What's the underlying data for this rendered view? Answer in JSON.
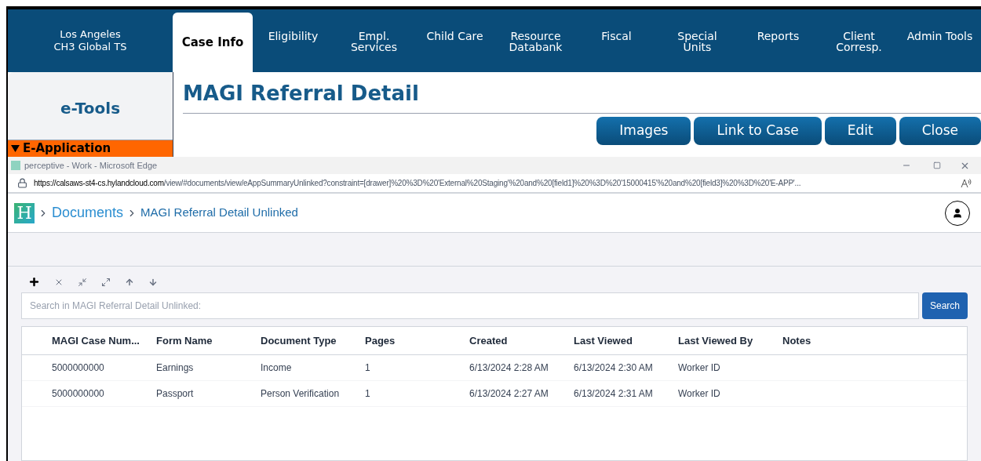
{
  "header": {
    "location": "Los Angeles",
    "office": "CH3 Global TS"
  },
  "tabs": [
    {
      "label": "Case Info",
      "selected": true
    },
    {
      "label": "Eligibility",
      "selected": false
    },
    {
      "label": "Empl. Services",
      "selected": false
    },
    {
      "label": "Child Care",
      "selected": false
    },
    {
      "label": "Resource Databank",
      "selected": false
    },
    {
      "label": "Fiscal",
      "selected": false
    },
    {
      "label": "Special\nUnits",
      "selected": false
    },
    {
      "label": "Reports",
      "selected": false
    },
    {
      "label": "Client Corresp.",
      "selected": false
    },
    {
      "label": "Admin Tools",
      "selected": false
    }
  ],
  "sidebar": {
    "title": "e-Tools",
    "section": {
      "label": "E-Application",
      "expanded": true
    }
  },
  "page": {
    "title": "MAGI Referral Detail",
    "buttons": [
      "Images",
      "Link to Case",
      "Edit",
      "Close"
    ]
  },
  "browser": {
    "title": "perceptive - Work - Microsoft Edge",
    "url_host": "https://calsaws-st4-cs.hylandcloud.com",
    "url_path": "/view/#documents/view/eAppSummaryUnlinked?constraint=[drawer]%20%3D%20'External%20Staging'%20and%20[field1]%20%3D%20'15000415'%20and%20[field3]%20%3D%20'E-APP'..."
  },
  "app": {
    "logo": "H",
    "breadcrumbs": [
      "Documents",
      "MAGI Referral Detail Unlinked"
    ],
    "search": {
      "placeholder": "Search in MAGI Referral Detail Unlinked:",
      "button": "Search"
    },
    "table": {
      "columns": [
        "MAGI Case Num...",
        "Form Name",
        "Document Type",
        "Pages",
        "Created",
        "Last Viewed",
        "Last Viewed By",
        "Notes"
      ],
      "rows": [
        [
          "5000000000",
          "Earnings",
          "Income",
          "1",
          "6/13/2024 2:28 AM",
          "6/13/2024 2:30 AM",
          "Worker ID",
          ""
        ],
        [
          "5000000000",
          "Passport",
          "Person Verification",
          "1",
          "6/13/2024 2:27 AM",
          "6/13/2024 2:31 AM",
          "Worker ID",
          ""
        ]
      ]
    }
  }
}
